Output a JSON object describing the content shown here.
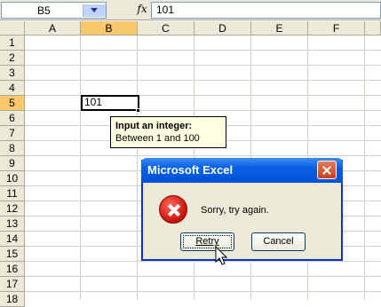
{
  "formula_bar": {
    "name_box": "B5",
    "fx": "fx",
    "formula": "101"
  },
  "columns": [
    "A",
    "B",
    "C",
    "D",
    "E",
    "F"
  ],
  "rows": [
    "1",
    "2",
    "3",
    "4",
    "5",
    "6",
    "7",
    "8",
    "9",
    "10",
    "11",
    "12",
    "13",
    "14",
    "15",
    "16",
    "17",
    "18"
  ],
  "active_cell": {
    "ref": "B5",
    "value": "101"
  },
  "input_tooltip": {
    "title": "Input an integer:",
    "body": "Between 1 and 100"
  },
  "dialog": {
    "title": "Microsoft Excel",
    "message": "Sorry, try again.",
    "retry_label": "Retry",
    "cancel_label": "Cancel",
    "icon": "error-icon"
  },
  "colors": {
    "titlebar": "#0a5fe0",
    "header_active": "#f8c86a",
    "tooltip_bg": "#ffffe1"
  }
}
